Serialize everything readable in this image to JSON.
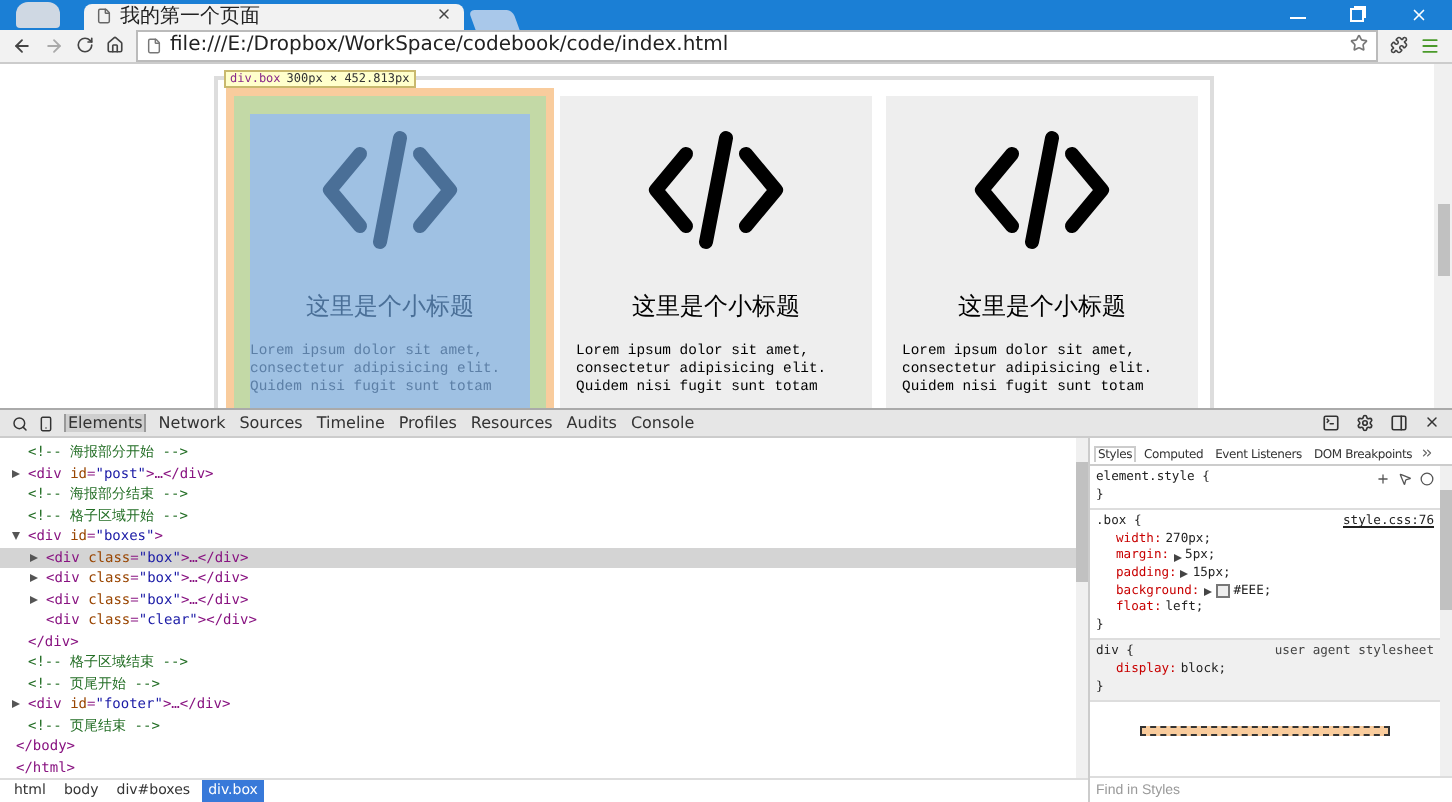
{
  "browser": {
    "tab_title": "我的第一个页面",
    "address": "file:///E:/Dropbox/WorkSpace/codebook/code/index.html"
  },
  "inspect_tooltip": {
    "selector": "div.box",
    "size": "300px × 452.813px"
  },
  "boxes": [
    {
      "title": "这里是个小标题",
      "text": "Lorem ipsum dolor sit amet, consectetur adipisicing elit. Quidem nisi fugit sunt totam",
      "highlighted": true
    },
    {
      "title": "这里是个小标题",
      "text": "Lorem ipsum dolor sit amet, consectetur adipisicing elit. Quidem nisi fugit sunt totam",
      "highlighted": false
    },
    {
      "title": "这里是个小标题",
      "text": "Lorem ipsum dolor sit amet, consectetur adipisicing elit. Quidem nisi fugit sunt totam",
      "highlighted": false
    }
  ],
  "devtools": {
    "tabs": [
      {
        "label": "Elements",
        "selected": true
      },
      {
        "label": "Network",
        "selected": false
      },
      {
        "label": "Sources",
        "selected": false
      },
      {
        "label": "Timeline",
        "selected": false
      },
      {
        "label": "Profiles",
        "selected": false
      },
      {
        "label": "Resources",
        "selected": false
      },
      {
        "label": "Audits",
        "selected": false
      },
      {
        "label": "Console",
        "selected": false
      }
    ],
    "dom": [
      {
        "kind": "hidden-open",
        "close": "</html>",
        "children": [
          {
            "kind": "hidden-open",
            "close": "</body>",
            "children": [
              {
                "kind": "comment",
                "text": "<!-- 海报部分开始 -->"
              },
              {
                "kind": "element",
                "text": "<div id=\"post\">…</div>",
                "expanded": false,
                "selected": false
              },
              {
                "kind": "comment",
                "text": "<!-- 海报部分结束 -->"
              },
              {
                "kind": "comment",
                "text": "<!-- 格子区域开始 -->"
              },
              {
                "kind": "element",
                "text": "<div id=\"boxes\">",
                "expanded": true,
                "selected": false,
                "close": "</div>",
                "children": [
                  {
                    "kind": "element",
                    "text": "<div class=\"box\">…</div>",
                    "expanded": false,
                    "selected": true
                  },
                  {
                    "kind": "element",
                    "text": "<div class=\"box\">…</div>",
                    "expanded": false,
                    "selected": false
                  },
                  {
                    "kind": "element",
                    "text": "<div class=\"box\">…</div>",
                    "expanded": false,
                    "selected": false
                  },
                  {
                    "kind": "leaf",
                    "text": "<div class=\"clear\"></div>",
                    "selected": false
                  }
                ]
              },
              {
                "kind": "comment",
                "text": "<!-- 格子区域结束 -->"
              },
              {
                "kind": "comment",
                "text": "<!-- 页尾开始 -->"
              },
              {
                "kind": "element",
                "text": "<div id=\"footer\">…</div>",
                "expanded": false,
                "selected": false
              },
              {
                "kind": "comment",
                "text": "<!-- 页尾结束 -->"
              }
            ]
          }
        ]
      }
    ],
    "breadcrumb": [
      {
        "label": "html",
        "selected": false
      },
      {
        "label": "body",
        "selected": false
      },
      {
        "label": "div#boxes",
        "selected": false
      },
      {
        "label": "div.box",
        "selected": true
      }
    ],
    "styles": {
      "tabs": [
        {
          "label": "Styles",
          "selected": true
        },
        {
          "label": "Computed",
          "selected": false
        },
        {
          "label": "Event Listeners",
          "selected": false
        },
        {
          "label": "DOM Breakpoints",
          "selected": false
        }
      ],
      "rules": [
        {
          "selector": "element.style {",
          "close": "}",
          "user_agent": false
        },
        {
          "selector": ".box {",
          "source": "style.css:76",
          "close": "}",
          "user_agent": false,
          "declarations": [
            {
              "property": "width:",
              "value": "270px;",
              "expandable": false,
              "swatch": false
            },
            {
              "property": "margin:",
              "value": "5px;",
              "expandable": true,
              "swatch": false
            },
            {
              "property": "padding:",
              "value": "15px;",
              "expandable": true,
              "swatch": false
            },
            {
              "property": "background:",
              "value": "#EEE;",
              "expandable": true,
              "swatch": true
            },
            {
              "property": "float:",
              "value": "left;",
              "expandable": false,
              "swatch": false
            }
          ]
        },
        {
          "selector": "div {",
          "source": "user agent stylesheet",
          "close": "}",
          "user_agent": true,
          "declarations": [
            {
              "property": "display:",
              "value": "block;",
              "expandable": false,
              "swatch": false
            }
          ]
        }
      ],
      "filter_placeholder": "Find in Styles"
    }
  }
}
